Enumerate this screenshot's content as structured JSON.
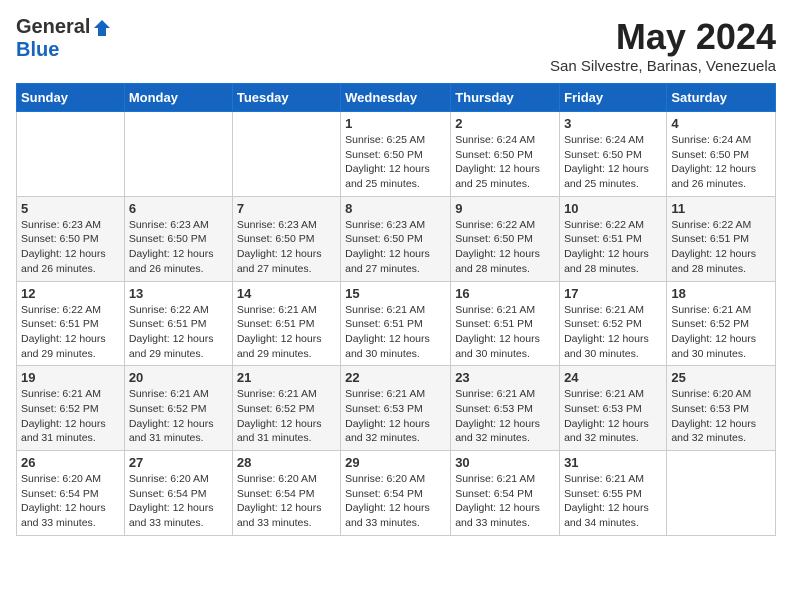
{
  "logo": {
    "general": "General",
    "blue": "Blue"
  },
  "title": "May 2024",
  "subtitle": "San Silvestre, Barinas, Venezuela",
  "days_of_week": [
    "Sunday",
    "Monday",
    "Tuesday",
    "Wednesday",
    "Thursday",
    "Friday",
    "Saturday"
  ],
  "weeks": [
    [
      {
        "day": "",
        "info": ""
      },
      {
        "day": "",
        "info": ""
      },
      {
        "day": "",
        "info": ""
      },
      {
        "day": "1",
        "info": "Sunrise: 6:25 AM\nSunset: 6:50 PM\nDaylight: 12 hours\nand 25 minutes."
      },
      {
        "day": "2",
        "info": "Sunrise: 6:24 AM\nSunset: 6:50 PM\nDaylight: 12 hours\nand 25 minutes."
      },
      {
        "day": "3",
        "info": "Sunrise: 6:24 AM\nSunset: 6:50 PM\nDaylight: 12 hours\nand 25 minutes."
      },
      {
        "day": "4",
        "info": "Sunrise: 6:24 AM\nSunset: 6:50 PM\nDaylight: 12 hours\nand 26 minutes."
      }
    ],
    [
      {
        "day": "5",
        "info": "Sunrise: 6:23 AM\nSunset: 6:50 PM\nDaylight: 12 hours\nand 26 minutes."
      },
      {
        "day": "6",
        "info": "Sunrise: 6:23 AM\nSunset: 6:50 PM\nDaylight: 12 hours\nand 26 minutes."
      },
      {
        "day": "7",
        "info": "Sunrise: 6:23 AM\nSunset: 6:50 PM\nDaylight: 12 hours\nand 27 minutes."
      },
      {
        "day": "8",
        "info": "Sunrise: 6:23 AM\nSunset: 6:50 PM\nDaylight: 12 hours\nand 27 minutes."
      },
      {
        "day": "9",
        "info": "Sunrise: 6:22 AM\nSunset: 6:50 PM\nDaylight: 12 hours\nand 28 minutes."
      },
      {
        "day": "10",
        "info": "Sunrise: 6:22 AM\nSunset: 6:51 PM\nDaylight: 12 hours\nand 28 minutes."
      },
      {
        "day": "11",
        "info": "Sunrise: 6:22 AM\nSunset: 6:51 PM\nDaylight: 12 hours\nand 28 minutes."
      }
    ],
    [
      {
        "day": "12",
        "info": "Sunrise: 6:22 AM\nSunset: 6:51 PM\nDaylight: 12 hours\nand 29 minutes."
      },
      {
        "day": "13",
        "info": "Sunrise: 6:22 AM\nSunset: 6:51 PM\nDaylight: 12 hours\nand 29 minutes."
      },
      {
        "day": "14",
        "info": "Sunrise: 6:21 AM\nSunset: 6:51 PM\nDaylight: 12 hours\nand 29 minutes."
      },
      {
        "day": "15",
        "info": "Sunrise: 6:21 AM\nSunset: 6:51 PM\nDaylight: 12 hours\nand 30 minutes."
      },
      {
        "day": "16",
        "info": "Sunrise: 6:21 AM\nSunset: 6:51 PM\nDaylight: 12 hours\nand 30 minutes."
      },
      {
        "day": "17",
        "info": "Sunrise: 6:21 AM\nSunset: 6:52 PM\nDaylight: 12 hours\nand 30 minutes."
      },
      {
        "day": "18",
        "info": "Sunrise: 6:21 AM\nSunset: 6:52 PM\nDaylight: 12 hours\nand 30 minutes."
      }
    ],
    [
      {
        "day": "19",
        "info": "Sunrise: 6:21 AM\nSunset: 6:52 PM\nDaylight: 12 hours\nand 31 minutes."
      },
      {
        "day": "20",
        "info": "Sunrise: 6:21 AM\nSunset: 6:52 PM\nDaylight: 12 hours\nand 31 minutes."
      },
      {
        "day": "21",
        "info": "Sunrise: 6:21 AM\nSunset: 6:52 PM\nDaylight: 12 hours\nand 31 minutes."
      },
      {
        "day": "22",
        "info": "Sunrise: 6:21 AM\nSunset: 6:53 PM\nDaylight: 12 hours\nand 32 minutes."
      },
      {
        "day": "23",
        "info": "Sunrise: 6:21 AM\nSunset: 6:53 PM\nDaylight: 12 hours\nand 32 minutes."
      },
      {
        "day": "24",
        "info": "Sunrise: 6:21 AM\nSunset: 6:53 PM\nDaylight: 12 hours\nand 32 minutes."
      },
      {
        "day": "25",
        "info": "Sunrise: 6:20 AM\nSunset: 6:53 PM\nDaylight: 12 hours\nand 32 minutes."
      }
    ],
    [
      {
        "day": "26",
        "info": "Sunrise: 6:20 AM\nSunset: 6:54 PM\nDaylight: 12 hours\nand 33 minutes."
      },
      {
        "day": "27",
        "info": "Sunrise: 6:20 AM\nSunset: 6:54 PM\nDaylight: 12 hours\nand 33 minutes."
      },
      {
        "day": "28",
        "info": "Sunrise: 6:20 AM\nSunset: 6:54 PM\nDaylight: 12 hours\nand 33 minutes."
      },
      {
        "day": "29",
        "info": "Sunrise: 6:20 AM\nSunset: 6:54 PM\nDaylight: 12 hours\nand 33 minutes."
      },
      {
        "day": "30",
        "info": "Sunrise: 6:21 AM\nSunset: 6:54 PM\nDaylight: 12 hours\nand 33 minutes."
      },
      {
        "day": "31",
        "info": "Sunrise: 6:21 AM\nSunset: 6:55 PM\nDaylight: 12 hours\nand 34 minutes."
      },
      {
        "day": "",
        "info": ""
      }
    ]
  ]
}
